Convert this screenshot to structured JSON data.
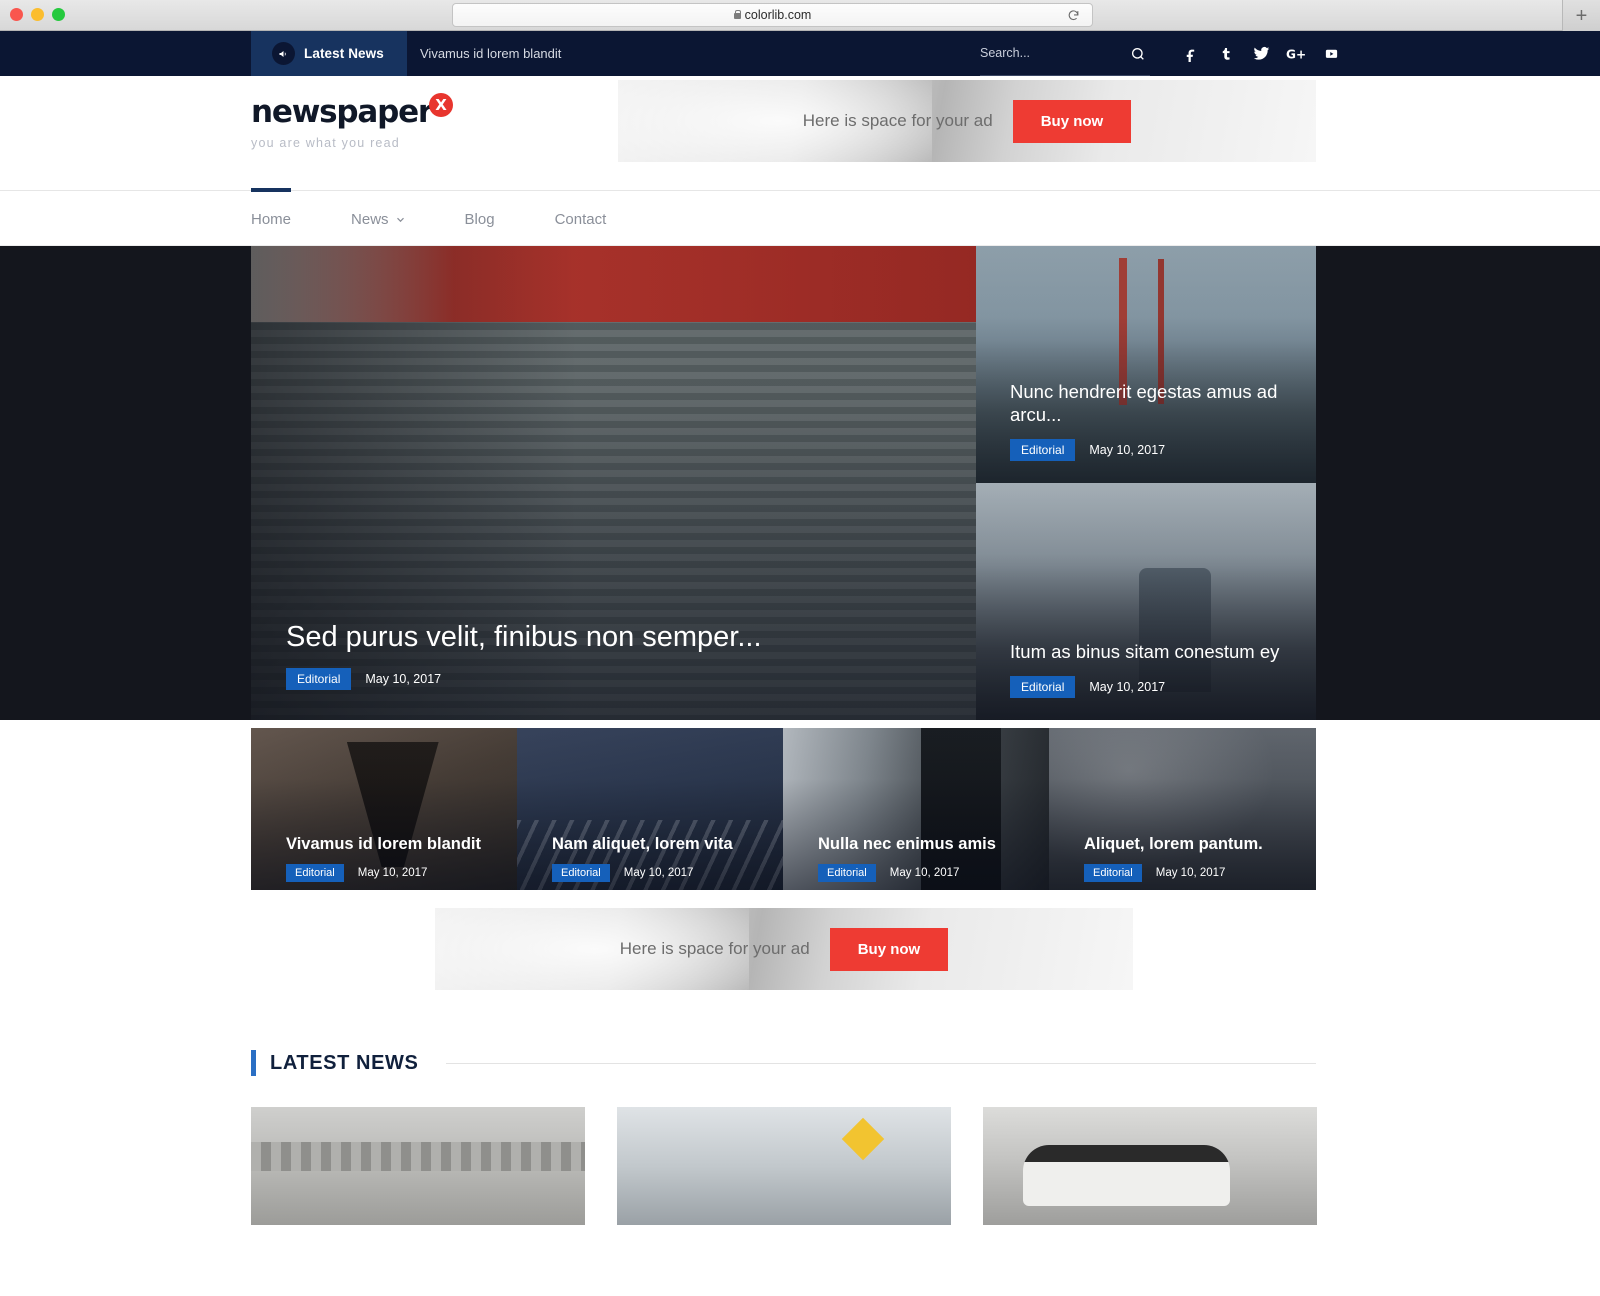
{
  "browser": {
    "url": "colorlib.com",
    "lock_icon": "lock-icon",
    "reload_icon": "reload-icon",
    "newtab_label": "+",
    "traffic_lights": [
      "close",
      "minimize",
      "maximize"
    ]
  },
  "topbar": {
    "megaphone_icon": "megaphone-icon",
    "latest_label": "Latest News",
    "ticker_text": "Vivamus id lorem blandit",
    "search_placeholder": "Search...",
    "search_value": "",
    "search_icon": "search-icon",
    "socials": [
      {
        "name": "facebook-icon",
        "glyph": "f"
      },
      {
        "name": "tumblr-icon",
        "glyph": "t"
      },
      {
        "name": "twitter-icon",
        "glyph": "t"
      },
      {
        "name": "google-plus-icon",
        "glyph": "G+"
      },
      {
        "name": "youtube-icon",
        "glyph": "▶"
      }
    ]
  },
  "header": {
    "logo_word": "newspaper",
    "logo_mark": "X",
    "tagline": "you are what you read",
    "ad": {
      "text": "Here is space for your ad",
      "button": "Buy now"
    }
  },
  "nav": {
    "items": [
      {
        "label": "Home",
        "active": true,
        "has_dropdown": false
      },
      {
        "label": "News",
        "active": false,
        "has_dropdown": true
      },
      {
        "label": "Blog",
        "active": false,
        "has_dropdown": false
      },
      {
        "label": "Contact",
        "active": false,
        "has_dropdown": false
      }
    ]
  },
  "hero": {
    "main": {
      "title": "Sed purus velit, finibus non semper...",
      "tag": "Editorial",
      "date": "May 10, 2017"
    },
    "side": [
      {
        "title": "Nunc hendrerit egestas amus ad arcu...",
        "tag": "Editorial",
        "date": "May 10, 2017"
      },
      {
        "title": "Itum as binus sitam conestum ey",
        "tag": "Editorial",
        "date": "May 10, 2017"
      }
    ]
  },
  "cards": [
    {
      "title": "Vivamus id lorem blandit",
      "tag": "Editorial",
      "date": "May 10, 2017"
    },
    {
      "title": "Nam aliquet, lorem vita",
      "tag": "Editorial",
      "date": "May 10, 2017"
    },
    {
      "title": "Nulla nec enimus amis",
      "tag": "Editorial",
      "date": "May 10, 2017"
    },
    {
      "title": "Aliquet, lorem pantum.",
      "tag": "Editorial",
      "date": "May 10, 2017"
    }
  ],
  "ad_mid": {
    "text": "Here is space for your ad",
    "button": "Buy now"
  },
  "latest_news": {
    "section_title": "LATEST NEWS"
  },
  "colors": {
    "topbar_bg": "#0b1633",
    "badge_bg": "#17335f",
    "accent_red": "#ee3b33",
    "tag_blue": "#1560ba",
    "section_blue": "#2a6fc4",
    "hero_bg": "#14161d",
    "logo_dark": "#101828"
  }
}
